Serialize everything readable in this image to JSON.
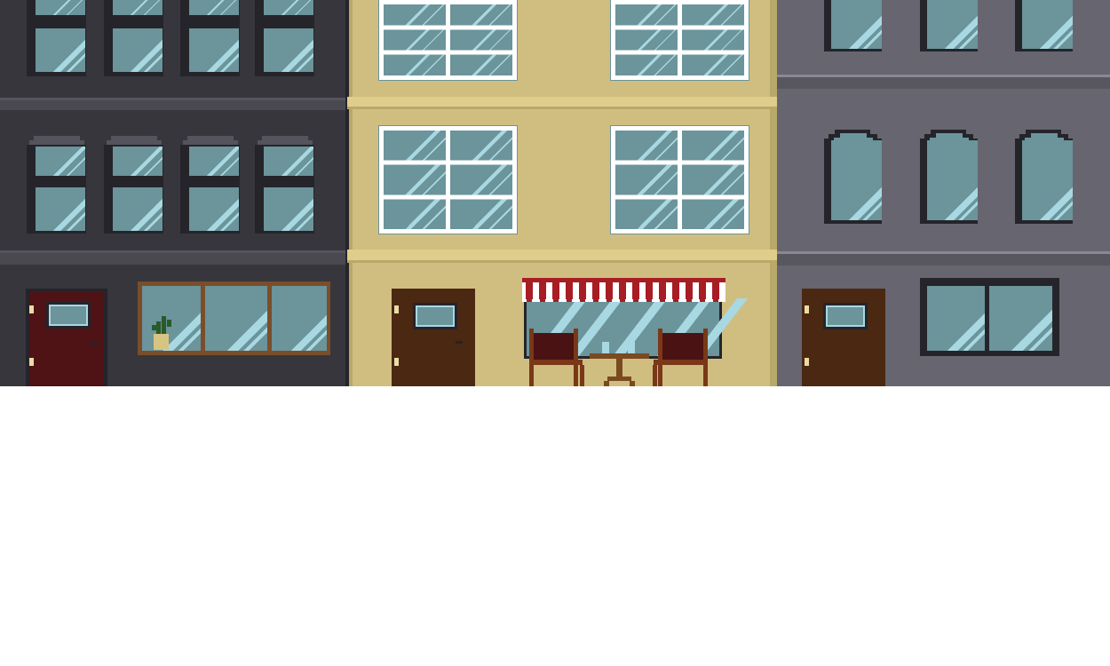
{
  "scene": {
    "type": "pixel-art-street",
    "background": "#ffffff",
    "glass": {
      "base": "#6b949b",
      "shine": "#a8d8e2",
      "frame_dark": "#25242a"
    },
    "buildings": [
      {
        "name": "dark-building",
        "wall": "#37363c",
        "ledge": "#4a4950",
        "ledge_top": "#55545c"
      },
      {
        "name": "cream-building",
        "wall": "#d0be80",
        "ledge": "#e0cd8c",
        "ledge_top": "#b8a86a",
        "frame": "#ffffff"
      },
      {
        "name": "gray-building",
        "wall": "#67656f",
        "ledge": "#58565f",
        "ledge_top": "#8a8892"
      }
    ],
    "doors": {
      "maroon": "#4f1215",
      "brown": "#4a2812",
      "knob": "#ecdca4"
    },
    "awning": {
      "red": "#a71d24",
      "white": "#ffffff"
    },
    "furniture": {
      "chair_seat": "#4b1214",
      "chair_leg": "#7a3818",
      "table": "#7a4a20"
    },
    "plant": {
      "leaf": "#2a5a2a",
      "pot": "#d8c482"
    },
    "shop_frame": "#7a4e2a"
  }
}
